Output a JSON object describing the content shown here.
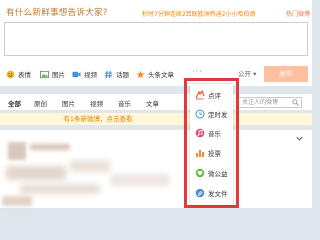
{
  "composer": {
    "prompt": "有什么新鲜事想告诉大家?",
    "hot_info": "秒时7分钟连续2耳联欧洲特迪2小小哈伯德",
    "hot_topics": "热门微博",
    "textarea_value": "",
    "tools": [
      {
        "label": "表情",
        "icon": "smile-icon"
      },
      {
        "label": "图片",
        "icon": "image-icon"
      },
      {
        "label": "视频",
        "icon": "video-icon"
      },
      {
        "label": "话题",
        "icon": "hashtag-icon"
      },
      {
        "label": "头条文章",
        "icon": "article-icon"
      }
    ],
    "more": "···",
    "visibility": "公开 ▾",
    "post_button": "发布"
  },
  "tabs": {
    "items": [
      "全部",
      "原创",
      "图片",
      "视频",
      "音乐",
      "文章"
    ],
    "search_placeholder": "关注人的微博"
  },
  "notice": {
    "text": "有1条新微博，点击查看"
  },
  "more_menu": {
    "items": [
      {
        "label": "点评",
        "icon": "review-icon"
      },
      {
        "label": "定时发",
        "icon": "clock-icon"
      },
      {
        "label": "音乐",
        "icon": "music-icon"
      },
      {
        "label": "投票",
        "icon": "vote-icon"
      },
      {
        "label": "微公益",
        "icon": "charity-icon"
      },
      {
        "label": "发文件",
        "icon": "file-icon"
      }
    ]
  },
  "colors": {
    "accent": "#ff8200",
    "post_button": "#ffc09f",
    "highlight_box": "#e23a3a",
    "notice_bg": "#fff8d8",
    "page_bg": "#dfe6ec"
  }
}
